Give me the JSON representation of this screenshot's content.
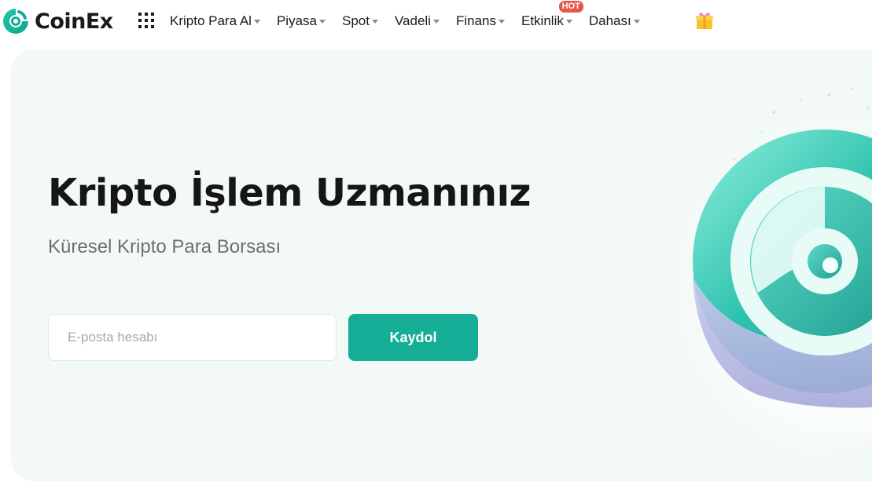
{
  "brand": {
    "name": "CoinEx",
    "accent": "#14ad95"
  },
  "nav": {
    "items": [
      {
        "label": "Kripto Para Al",
        "badge": ""
      },
      {
        "label": "Piyasa",
        "badge": ""
      },
      {
        "label": "Spot",
        "badge": ""
      },
      {
        "label": "Vadeli",
        "badge": ""
      },
      {
        "label": "Finans",
        "badge": ""
      },
      {
        "label": "Etkinlik",
        "badge": "HOT"
      },
      {
        "label": "Dahası",
        "badge": ""
      }
    ],
    "icons": [
      "apps-grid-icon",
      "gift-icon"
    ]
  },
  "hero": {
    "title": "Kripto İşlem Uzmanınız",
    "subtitle": "Küresel Kripto Para Borsası",
    "email_placeholder": "E-posta hesabı",
    "email_value": "",
    "signup_label": "Kaydol"
  }
}
